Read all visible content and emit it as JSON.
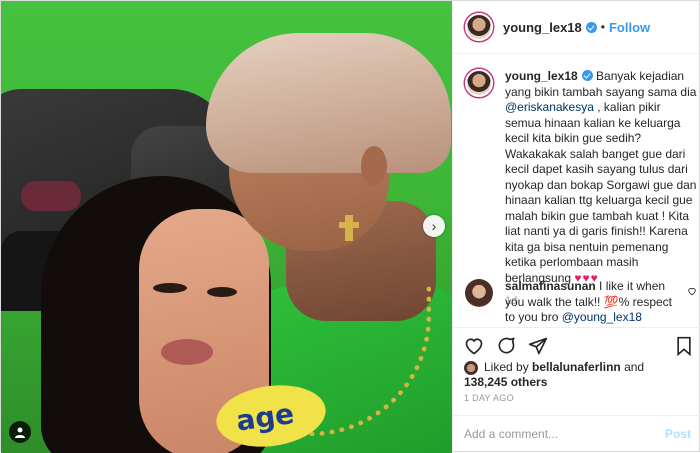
{
  "post": {
    "username": "young_lex18",
    "follow_label": "Follow",
    "dot": "•",
    "caption": {
      "username": "young_lex18",
      "text_before_mention": "Banyak kejadian yang bikin tambah sayang sama dia",
      "mention": "@eriskanakesya",
      "text_after_mention": ", kalian pikir semua hinaan kalian ke keluarga kecil kita bikin gue sedih? Wakakakak salah banget gue dari kecil dapet kasih sayang tulus dari nyokap dan bokap Sorgawi gue dan hinaan kalian ttg keluarga kecil gue malah bikin gue tambah kuat ! Kita liat nanti ya di garis finish!! Karena kita ga bisa nentuin pemenang ketika perlombaan masih berlangsung",
      "hearts": "♥♥♥",
      "age": "1d"
    },
    "comment": {
      "username": "salmafinasunan",
      "text_before_mention": "I like it when you walk the talk!! 💯% respect to you bro",
      "mention": "@young_lex18"
    },
    "likes": {
      "prefix": "Liked by",
      "liker": "bellalunaferlinn",
      "and": "and",
      "count": "138,245 others"
    },
    "timestamp": "1 DAY AGO",
    "add_comment_placeholder": "Add a comment...",
    "post_button": "Post",
    "photo_print": "age"
  },
  "colors": {
    "accent": "#3897f0",
    "verified": "#3897f0",
    "heart": "#e0245e"
  },
  "icons": [
    "verified-badge-icon",
    "next-arrow-icon",
    "tag-user-icon",
    "heart-icon",
    "comment-icon",
    "share-icon",
    "bookmark-icon"
  ]
}
